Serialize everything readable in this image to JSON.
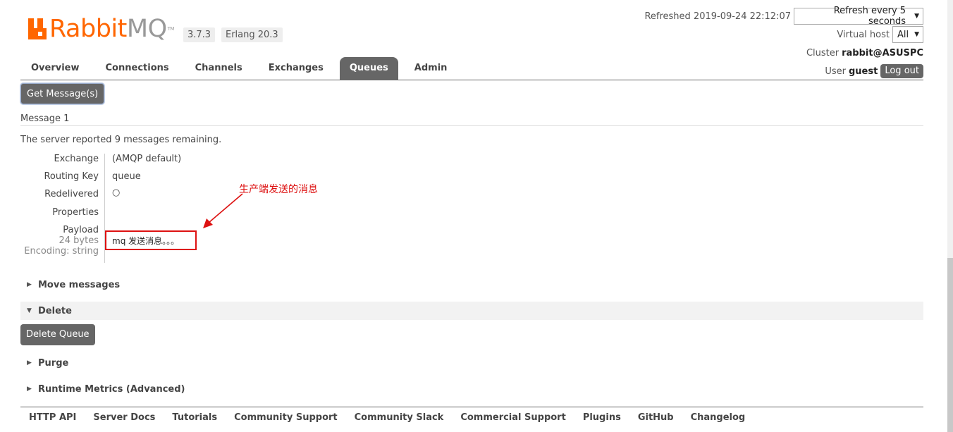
{
  "brand": {
    "name_part1": "Rabbit",
    "name_part2": "MQ",
    "tm": "TM",
    "accent": "#ff6600"
  },
  "versions": {
    "rabbitmq": "3.7.3",
    "erlang": "Erlang 20.3"
  },
  "status": {
    "refreshed_label": "Refreshed 2019-09-24 22:12:07",
    "refresh_select": "Refresh every 5 seconds",
    "vhost_label": "Virtual host",
    "vhost_select": "All",
    "cluster_label": "Cluster",
    "cluster_value": "rabbit@ASUSPC",
    "user_label": "User",
    "user_value": "guest",
    "logout_label": "Log out"
  },
  "nav": {
    "tabs": [
      {
        "label": "Overview"
      },
      {
        "label": "Connections"
      },
      {
        "label": "Channels"
      },
      {
        "label": "Exchanges"
      },
      {
        "label": "Queues",
        "active": true
      },
      {
        "label": "Admin"
      }
    ]
  },
  "messages": {
    "get_button": "Get Message(s)",
    "heading": "Message 1",
    "report_prefix": "The server reported ",
    "report_count": "9",
    "report_suffix": " messages remaining.",
    "props": {
      "exchange_label": "Exchange",
      "exchange_value": "(AMQP default)",
      "routing_key_label": "Routing Key",
      "routing_key_value": "queue",
      "redelivered_label": "Redelivered",
      "redelivered_value": "○",
      "properties_label": "Properties",
      "payload_label": "Payload",
      "payload_size": "24 bytes",
      "payload_encoding": "Encoding: string",
      "payload_value": "mq 发送消息。。。"
    },
    "annotation": "生产端发送的消息",
    "annotation_color": "#dd1111"
  },
  "sections": {
    "move": "Move messages",
    "delete": "Delete",
    "delete_button": "Delete Queue",
    "purge": "Purge",
    "runtime": "Runtime Metrics (Advanced)"
  },
  "footer": {
    "links": [
      "HTTP API",
      "Server Docs",
      "Tutorials",
      "Community Support",
      "Community Slack",
      "Commercial Support",
      "Plugins",
      "GitHub",
      "Changelog"
    ]
  }
}
